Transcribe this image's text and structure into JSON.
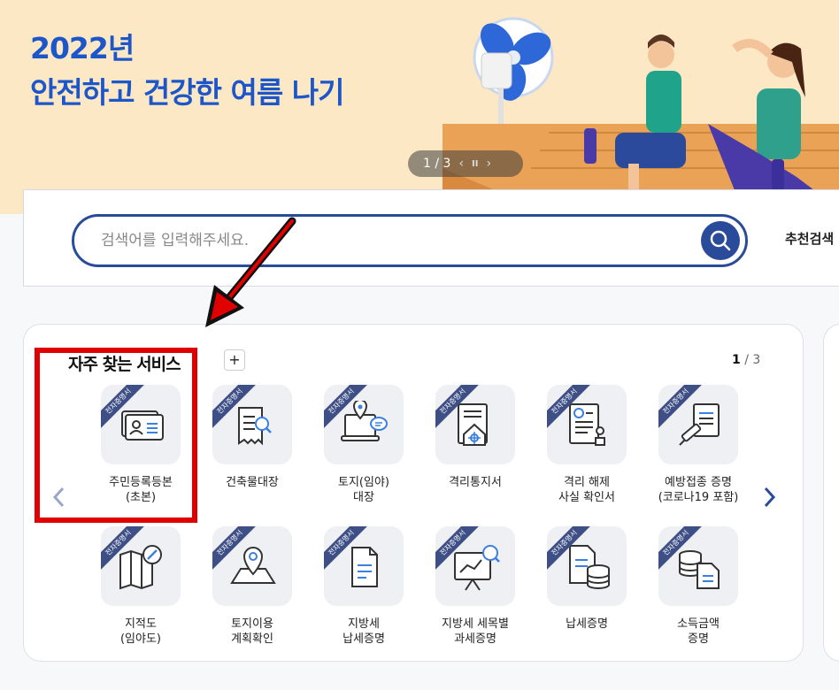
{
  "banner": {
    "title_line1": "2022년",
    "title_line2": "안전하고 건강한 여름 나기",
    "pager_text": "1 / 3",
    "pager_prev": "‹",
    "pager_pause": "II",
    "pager_next": "›"
  },
  "search": {
    "placeholder": "검색어를 입력해주세요.",
    "recommend_label": "추천검색"
  },
  "services": {
    "title": "자주 찾는 서비스",
    "add_label": "+",
    "page_current": "1",
    "page_total": " / 3",
    "badge": "전자증명서",
    "row1": [
      {
        "label": "주민등록등본\n(초본)"
      },
      {
        "label": "건축물대장"
      },
      {
        "label": "토지(임야)\n대장"
      },
      {
        "label": "격리통지서"
      },
      {
        "label": "격리 해제\n사실 확인서"
      },
      {
        "label": "예방접종 증명\n(코로나19 포함)"
      }
    ],
    "row2": [
      {
        "label": "지적도\n(임야도)"
      },
      {
        "label": "토지이용\n계획확인"
      },
      {
        "label": "지방세\n납세증명"
      },
      {
        "label": "지방세 세목별\n과세증명"
      },
      {
        "label": "납세증명"
      },
      {
        "label": "소득금액\n증명"
      }
    ]
  },
  "colors": {
    "brand_blue": "#2a4a9a",
    "banner_bg": "#fde8c6",
    "highlight_red": "#e10000"
  }
}
